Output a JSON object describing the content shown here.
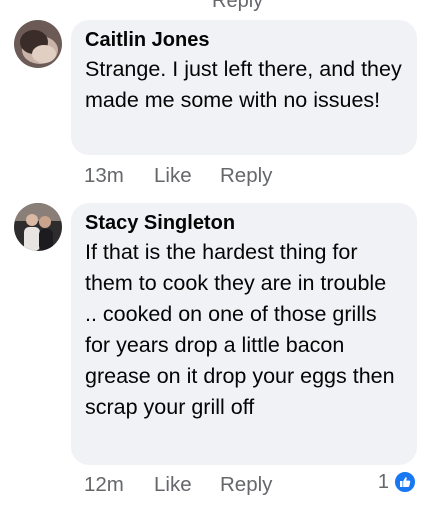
{
  "truncated_above": "Reply",
  "comments": [
    {
      "author": "Caitlin Jones",
      "text": "Strange. I just left there, and they made me some with no issues!",
      "time": "13m",
      "like_label": "Like",
      "reply_label": "Reply",
      "avatar_icon": "profile-photo"
    },
    {
      "author": "Stacy Singleton",
      "text": "If that is the hardest thing for them to cook they are in trouble .. cooked on one of those grills for years drop a little bacon grease on it drop your eggs then scrap your grill off",
      "time": "12m",
      "like_label": "Like",
      "reply_label": "Reply",
      "avatar_icon": "profile-photo",
      "reaction_count": "1",
      "reaction_icon": "thumbs-up-icon"
    }
  ],
  "colors": {
    "bubble": "#f0f2f5",
    "secondary_text": "#65676b",
    "like_blue": "#1877f2"
  }
}
